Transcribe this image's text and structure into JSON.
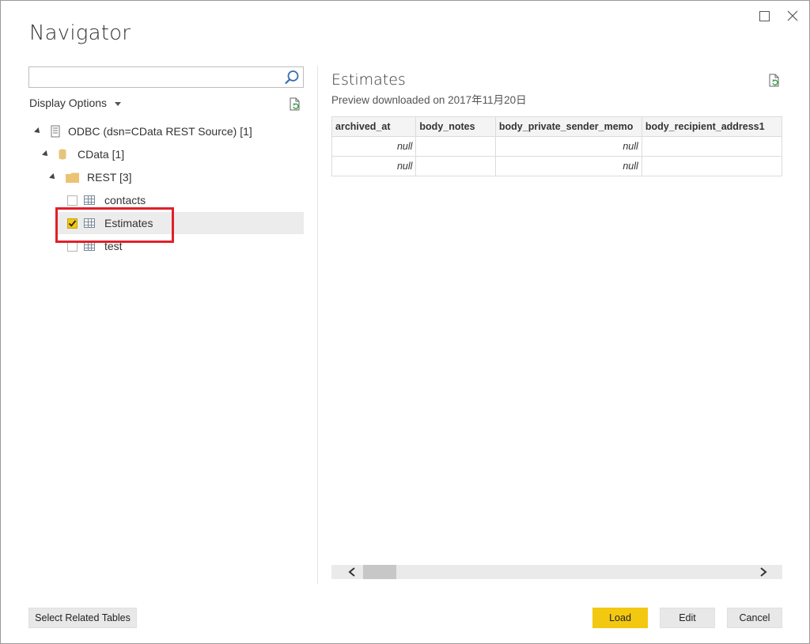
{
  "window": {
    "title": "Navigator",
    "controls": [
      "maximize-icon",
      "close-icon"
    ]
  },
  "left_pane": {
    "search": {
      "value": "",
      "placeholder": ""
    },
    "display_options_label": "Display Options",
    "tree": [
      {
        "label": "ODBC (dsn=CData REST Source) [1]",
        "icon": "odbc-server-icon",
        "level": 0,
        "expanded": true
      },
      {
        "label": "CData [1]",
        "icon": "database-icon",
        "level": 1,
        "expanded": true
      },
      {
        "label": "REST [3]",
        "icon": "folder-icon",
        "level": 2,
        "expanded": true
      },
      {
        "label": "contacts",
        "icon": "table-icon",
        "level": 3,
        "checked": false
      },
      {
        "label": "Estimates",
        "icon": "table-icon",
        "level": 3,
        "checked": true,
        "selected": true
      },
      {
        "label": "test",
        "icon": "table-icon",
        "level": 3,
        "checked": false
      }
    ]
  },
  "preview": {
    "title": "Estimates",
    "subtitle": "Preview downloaded on 2017年11月20日",
    "columns": [
      "archived_at",
      "body_notes",
      "body_private_sender_memo",
      "body_recipient_address1"
    ],
    "rows": [
      [
        "null",
        "",
        "null",
        ""
      ],
      [
        "null",
        "",
        "null",
        ""
      ]
    ]
  },
  "footer": {
    "select_related_label": "Select Related Tables",
    "load_label": "Load",
    "edit_label": "Edit",
    "cancel_label": "Cancel"
  },
  "colors": {
    "accent": "#f2c811",
    "highlight": "#e0202a",
    "selection": "#ececec"
  }
}
